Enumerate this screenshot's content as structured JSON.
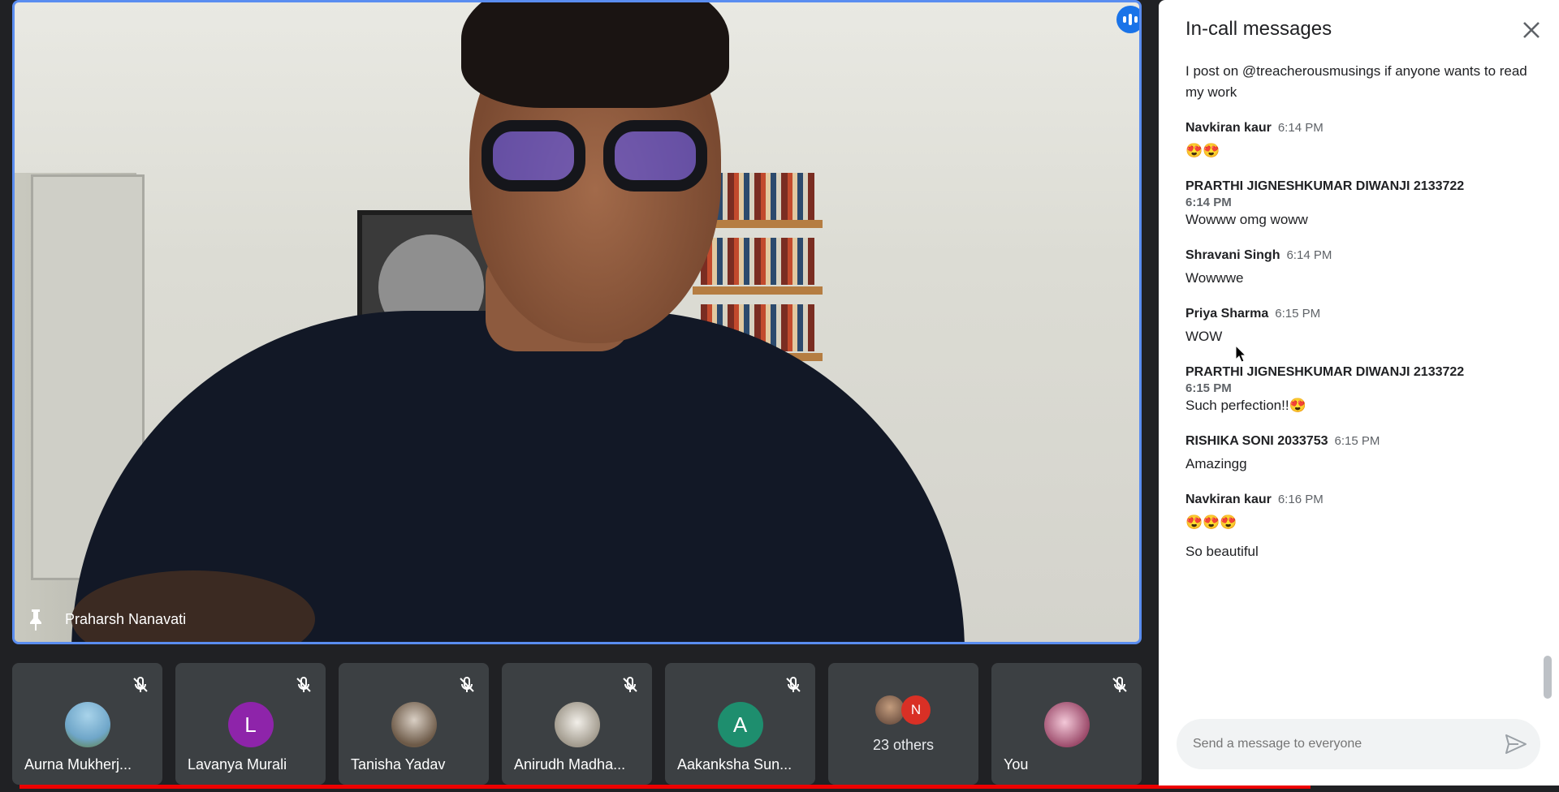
{
  "main_speaker": {
    "name": "Praharsh Nanavati"
  },
  "participants": [
    {
      "name": "Aurna Mukherj...",
      "avatar_color": "#6fa6c9",
      "initial": ""
    },
    {
      "name": "Lavanya Murali",
      "avatar_color": "#8e24aa",
      "initial": "L"
    },
    {
      "name": "Tanisha Yadav",
      "avatar_color": "#6d5a48",
      "initial": ""
    },
    {
      "name": "Anirudh Madha...",
      "avatar_color": "#a19a8d",
      "initial": ""
    },
    {
      "name": "Aakanksha Sun...",
      "avatar_color": "#1e8e6e",
      "initial": "A"
    }
  ],
  "others": {
    "label": "23 others",
    "badge_initial": "N",
    "badge_color": "#d93025"
  },
  "self_tile": {
    "name": "You"
  },
  "chat": {
    "title": "In-call messages",
    "close_icon": "close-icon",
    "compose_placeholder": "Send a message to everyone",
    "messages": [
      {
        "sender": "",
        "time": "",
        "texts": [
          "I post on @treacherousmusings if anyone wants to read my work"
        ]
      },
      {
        "sender": "Navkiran kaur",
        "time": "6:14 PM",
        "texts": [
          "😍😍"
        ]
      },
      {
        "sender": "PRARTHI JIGNESHKUMAR DIWANJI 2133722",
        "time": "6:14 PM",
        "texts": [
          "Wowww omg woww"
        ]
      },
      {
        "sender": "Shravani Singh",
        "time": "6:14 PM",
        "texts": [
          "Wowwwe"
        ]
      },
      {
        "sender": "Priya Sharma",
        "time": "6:15 PM",
        "texts": [
          "WOW"
        ]
      },
      {
        "sender": "PRARTHI JIGNESHKUMAR DIWANJI 2133722",
        "time": "6:15 PM",
        "texts": [
          "Such perfection!!😍"
        ]
      },
      {
        "sender": "RISHIKA SONI 2033753",
        "time": "6:15 PM",
        "texts": [
          "Amazingg"
        ]
      },
      {
        "sender": "Navkiran kaur",
        "time": "6:16 PM",
        "texts": [
          "😍😍😍",
          "So beautiful"
        ]
      }
    ]
  }
}
